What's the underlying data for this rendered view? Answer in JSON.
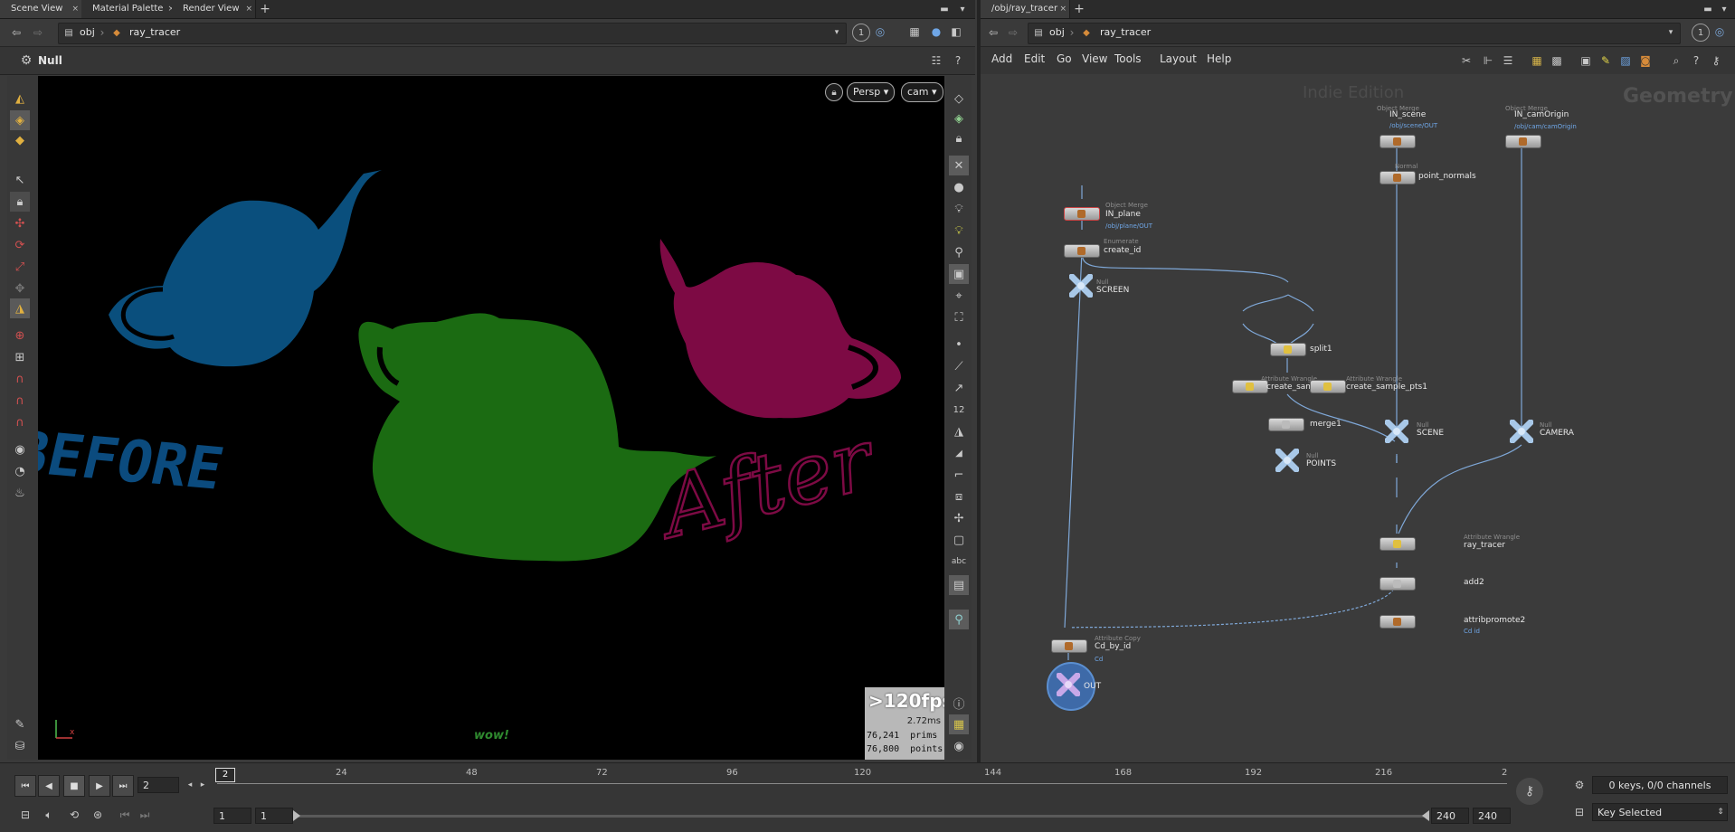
{
  "left_tabs": [
    "Scene View",
    "Material Palette",
    "Render View"
  ],
  "right_tabs": [
    "/obj/ray_tracer"
  ],
  "left_path": {
    "root": "obj",
    "node": "ray_tracer"
  },
  "right_path": {
    "root": "obj",
    "node": "ray_tracer"
  },
  "left_badge": "1",
  "right_badge": "1",
  "operation": "Null",
  "viewport": {
    "persp_label": "Persp ▾",
    "cam_label": "cam ▾",
    "fps": ">120fps",
    "ms": "2.72ms",
    "prims": "76,241  prims",
    "points": "76,800  points",
    "overlay_text": "wow!",
    "before_text": "BEFORE",
    "after_text": "After"
  },
  "network": {
    "menu": [
      "Add",
      "Edit",
      "Go",
      "View",
      "Tools",
      "Layout",
      "Help"
    ],
    "watermark": "Indie Edition",
    "context": "Geometry",
    "nodes": [
      {
        "id": "IN_scene",
        "type": "Object Merge",
        "label": "IN_scene",
        "path": "/obj/scene/OUT"
      },
      {
        "id": "IN_camOrigin",
        "type": "Object Merge",
        "label": "IN_camOrigin",
        "path": "/obj/cam/camOrigin"
      },
      {
        "id": "point_normals",
        "type": "Normal",
        "label": "point_normals",
        "path": ""
      },
      {
        "id": "IN_plane",
        "type": "Object Merge",
        "label": "IN_plane",
        "path": "/obj/plane/OUT"
      },
      {
        "id": "create_id",
        "type": "Enumerate",
        "label": "create_id",
        "path": ""
      },
      {
        "id": "SCREEN",
        "type": "Null",
        "label": "SCREEN",
        "path": ""
      },
      {
        "id": "split1",
        "type": "",
        "label": "split1",
        "path": ""
      },
      {
        "id": "create_sample",
        "type": "Attribute Wrangle",
        "label": "create_sampl",
        "path": ""
      },
      {
        "id": "create_sample_pts1",
        "type": "Attribute Wrangle",
        "label": "create_sample_pts1",
        "path": ""
      },
      {
        "id": "merge1",
        "type": "",
        "label": "merge1",
        "path": ""
      },
      {
        "id": "POINTS",
        "type": "Null",
        "label": "POINTS",
        "path": ""
      },
      {
        "id": "SCENE",
        "type": "Null",
        "label": "SCENE",
        "path": ""
      },
      {
        "id": "CAMERA",
        "type": "Null",
        "label": "CAMERA",
        "path": ""
      },
      {
        "id": "ray_tracer",
        "type": "Attribute Wrangle",
        "label": "ray_tracer",
        "path": ""
      },
      {
        "id": "add2",
        "type": "",
        "label": "add2",
        "path": ""
      },
      {
        "id": "attribpromote2",
        "type": "",
        "label": "attribpromote2",
        "path": "Cd id"
      },
      {
        "id": "Cd_by_id",
        "type": "Attribute Copy",
        "label": "Cd_by_id",
        "path": "Cd"
      },
      {
        "id": "OUT",
        "type": "",
        "label": "OUT",
        "path": ""
      }
    ]
  },
  "timeline": {
    "current_frame": "2",
    "marker": "2",
    "ticks": [
      "24",
      "48",
      "72",
      "96",
      "120",
      "144",
      "168",
      "192",
      "216",
      "2"
    ],
    "start1": "1",
    "start2": "1",
    "end1": "240",
    "end2": "240",
    "keys_info": "0 keys, 0/0 channels",
    "key_mode": "Key Selected"
  },
  "colors": {
    "teapot_blue": "#0a4f7d",
    "teapot_green": "#1b6b12",
    "teapot_magenta": "#7d0a44",
    "accent_blue": "#6fa6e6"
  }
}
